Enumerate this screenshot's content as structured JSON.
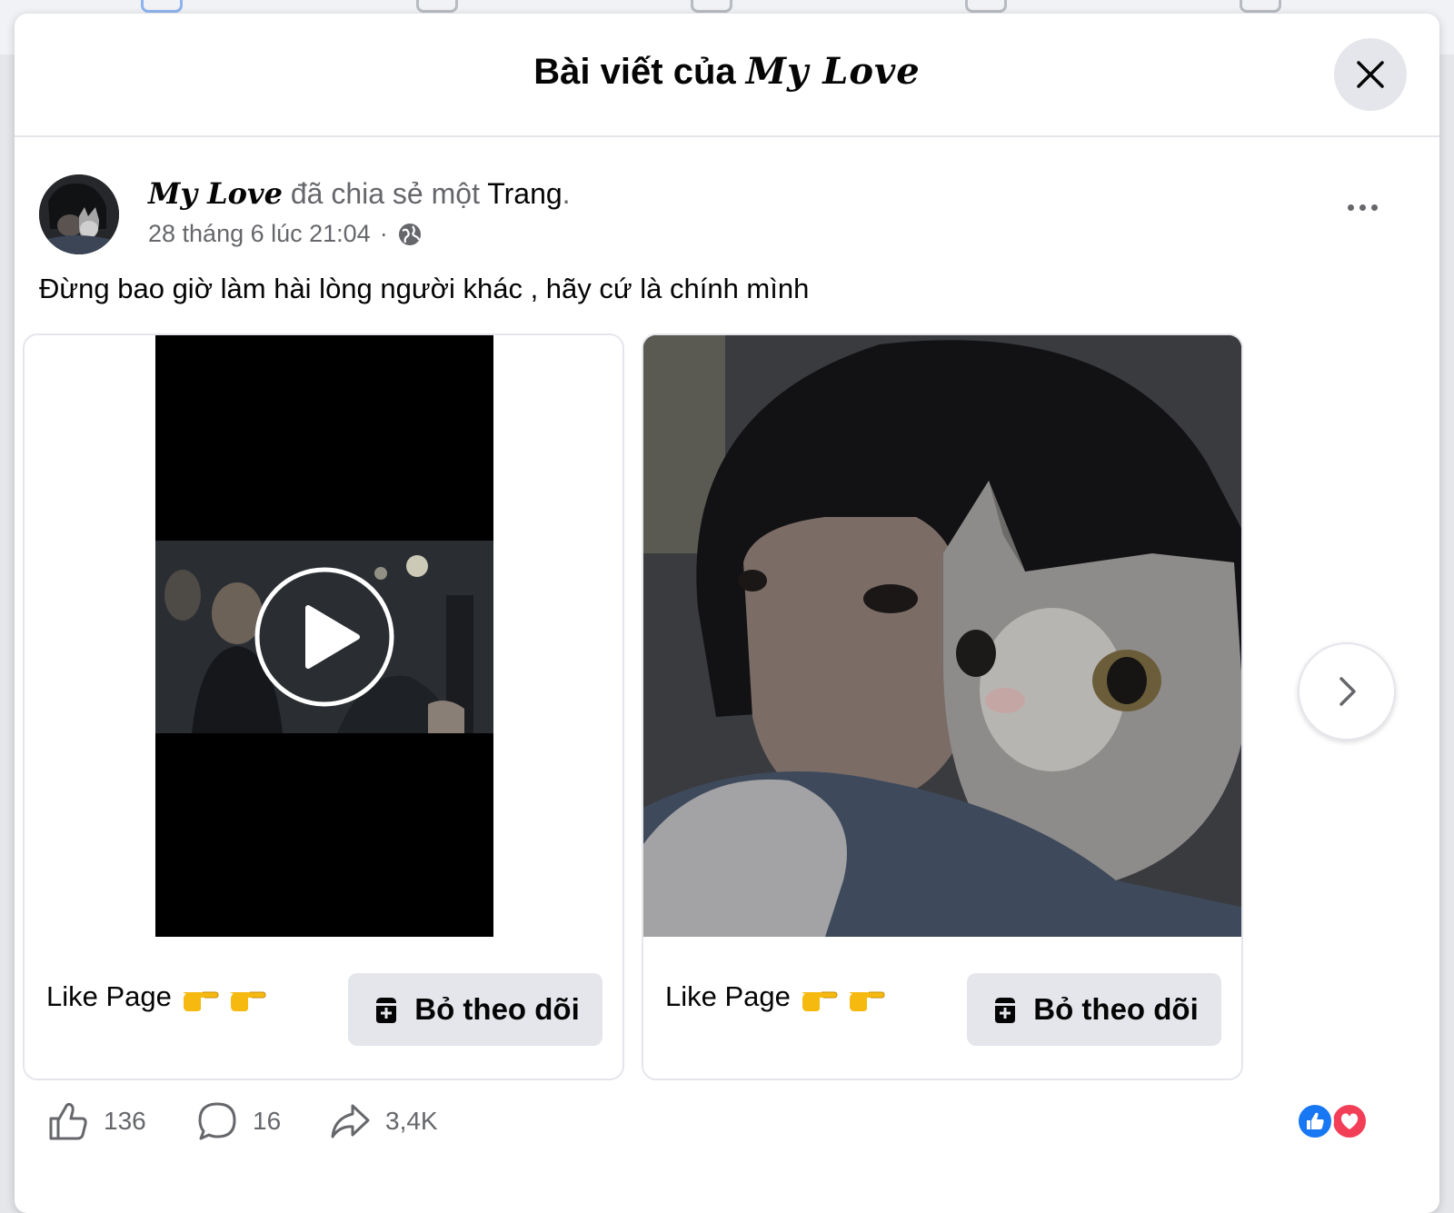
{
  "modal": {
    "title_prefix": "Bài viết của",
    "title_name": "My Love",
    "close_icon": "close-icon"
  },
  "post": {
    "author": "My Love",
    "shared_text": "đã chia sẻ một",
    "shared_object": "Trang",
    "period": ".",
    "date": "28 tháng 6 lúc 21:04",
    "separator": "·",
    "privacy_icon": "globe-icon",
    "text": "Đừng bao giờ làm hài lòng người khác , hãy cứ là chính mình"
  },
  "cards": [
    {
      "type": "video",
      "caption": "Like Page",
      "button_label": "Bỏ theo dõi"
    },
    {
      "type": "photo",
      "caption": "Like Page",
      "button_label": "Bỏ theo dõi"
    }
  ],
  "stats": {
    "likes": "136",
    "comments": "16",
    "shares": "3,4K"
  },
  "colors": {
    "like_blue": "#1877f2",
    "love_red": "#f33e58",
    "muted_text": "#65676b",
    "button_gray": "#e4e6eb"
  }
}
